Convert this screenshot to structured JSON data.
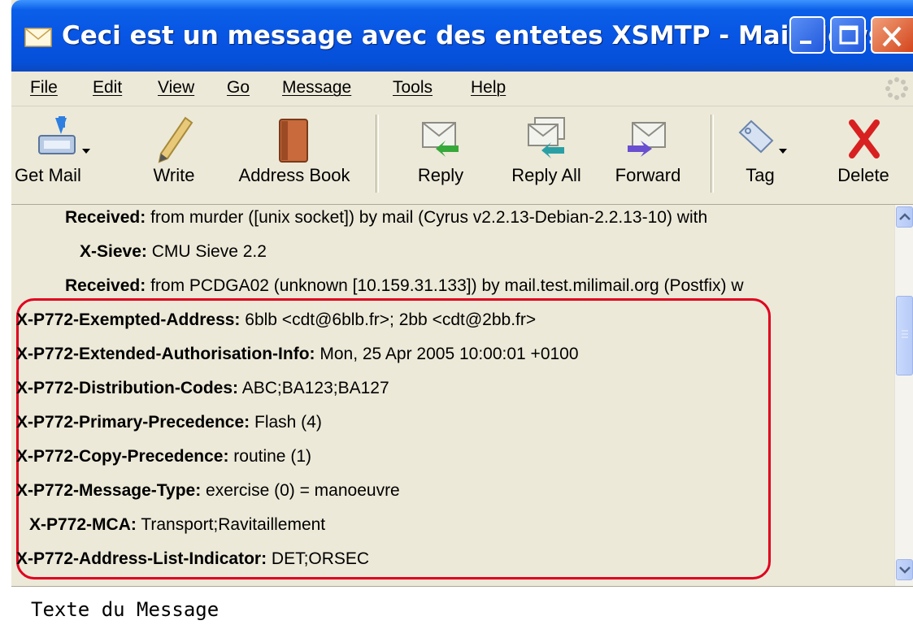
{
  "window": {
    "title": "Ceci est un message avec des entetes XSMTP - Mail/News",
    "controls": [
      "minimize",
      "maximize",
      "close"
    ]
  },
  "menu": {
    "items": [
      "File",
      "Edit",
      "View",
      "Go",
      "Message",
      "Tools",
      "Help"
    ]
  },
  "toolbar": {
    "buttons": [
      {
        "label": "Get Mail",
        "icon": "get-mail-icon"
      },
      {
        "label": "Write",
        "icon": "pencil-icon"
      },
      {
        "label": "Address Book",
        "icon": "address-book-icon"
      },
      {
        "label": "Reply",
        "icon": "reply-icon"
      },
      {
        "label": "Reply All",
        "icon": "reply-all-icon"
      },
      {
        "label": "Forward",
        "icon": "forward-icon"
      },
      {
        "label": "Tag",
        "icon": "tag-icon"
      },
      {
        "label": "Delete",
        "icon": "delete-icon"
      }
    ]
  },
  "headers": [
    {
      "name": "Received:",
      "value": "from murder ([unix socket])     by mail (Cyrus v2.2.13-Debian-2.2.13-10) with"
    },
    {
      "name": "X-Sieve:",
      "value": "CMU Sieve 2.2"
    },
    {
      "name": "Received:",
      "value": "from PCDGA02 (unknown [10.159.31.133])  by mail.test.milimail.org (Postfix) w"
    },
    {
      "name": "X-P772-Exempted-Address:",
      "value": "6blb <cdt@6blb.fr>; 2bb <cdt@2bb.fr>"
    },
    {
      "name": "X-P772-Extended-Authorisation-Info:",
      "value": "Mon, 25 Apr 2005 10:00:01 +0100"
    },
    {
      "name": "X-P772-Distribution-Codes:",
      "value": "ABC;BA123;BA127"
    },
    {
      "name": "X-P772-Primary-Precedence:",
      "value": "Flash (4)"
    },
    {
      "name": "X-P772-Copy-Precedence:",
      "value": "routine (1)"
    },
    {
      "name": "X-P772-Message-Type:",
      "value": "exercise (0) = manoeuvre"
    },
    {
      "name": "X-P772-MCA:",
      "value": "Transport;Ravitaillement"
    },
    {
      "name": "X-P772-Address-List-Indicator:",
      "value": "DET;ORSEC"
    }
  ],
  "message": {
    "body": "Texte du Message"
  },
  "colors": {
    "titlebar": "#0854e3",
    "highlight_border": "#e0001f",
    "chrome": "#ece9d8"
  }
}
